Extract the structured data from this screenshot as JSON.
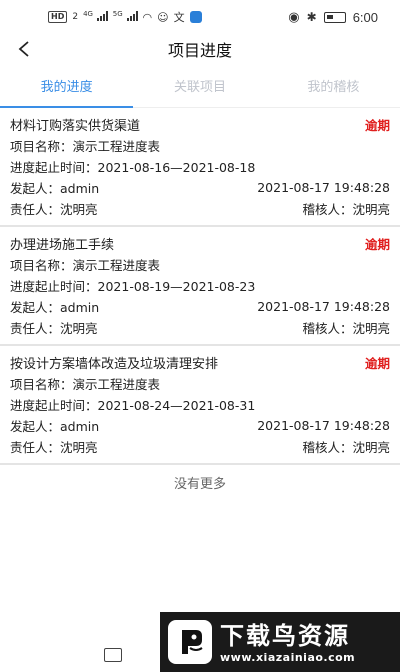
{
  "status_bar": {
    "hd": "HD",
    "hd_num": "2",
    "net1": "4G",
    "net2": "5G",
    "time": "6:00"
  },
  "header": {
    "title": "项目进度"
  },
  "tabs": [
    {
      "label": "我的进度",
      "active": true
    },
    {
      "label": "关联项目",
      "active": false
    },
    {
      "label": "我的稽核",
      "active": false
    }
  ],
  "labels": {
    "project_name": "项目名称：",
    "date_range": "进度起止时间：",
    "initiator": "发起人：",
    "responsible": "责任人：",
    "auditor": "稽核人："
  },
  "cards": [
    {
      "title": "材料订购落实供货渠道",
      "status": "逾期",
      "project_name": "演示工程进度表",
      "date_range": "2021-08-16—2021-08-18",
      "initiator": "admin",
      "created": "2021-08-17 19:48:28",
      "responsible": "沈明亮",
      "auditor": "沈明亮"
    },
    {
      "title": "办理进场施工手续",
      "status": "逾期",
      "project_name": "演示工程进度表",
      "date_range": "2021-08-19—2021-08-23",
      "initiator": "admin",
      "created": "2021-08-17 19:48:28",
      "responsible": "沈明亮",
      "auditor": "沈明亮"
    },
    {
      "title": "按设计方案墙体改造及垃圾清理安排",
      "status": "逾期",
      "project_name": "演示工程进度表",
      "date_range": "2021-08-24—2021-08-31",
      "initiator": "admin",
      "created": "2021-08-17 19:48:28",
      "responsible": "沈明亮",
      "auditor": "沈明亮"
    }
  ],
  "no_more": "没有更多",
  "watermark": {
    "title": "下载鸟资源",
    "url": "www.xiazainiao.com"
  },
  "colors": {
    "accent": "#3a8ee6",
    "overdue": "#e0201f"
  }
}
